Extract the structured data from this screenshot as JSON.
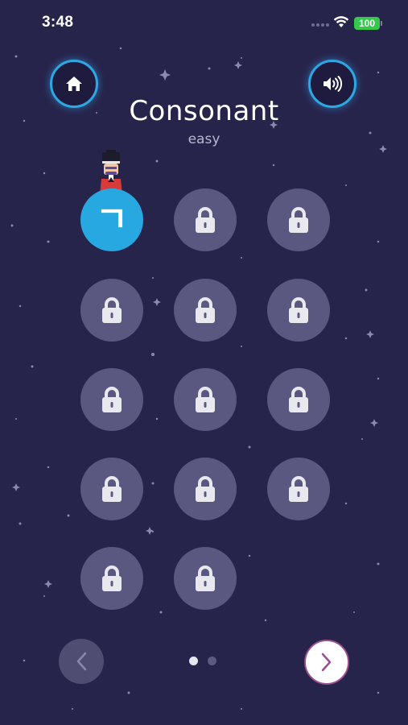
{
  "status_bar": {
    "time": "3:48",
    "battery": "100"
  },
  "header": {
    "title": "Consonant",
    "subtitle": "easy",
    "home_icon": "home-icon",
    "sound_icon": "speaker-volume-icon"
  },
  "levels": [
    {
      "state": "unlocked",
      "symbol": "ㄱ"
    },
    {
      "state": "locked"
    },
    {
      "state": "locked"
    },
    {
      "state": "locked"
    },
    {
      "state": "locked"
    },
    {
      "state": "locked"
    },
    {
      "state": "locked"
    },
    {
      "state": "locked"
    },
    {
      "state": "locked"
    },
    {
      "state": "locked"
    },
    {
      "state": "locked"
    },
    {
      "state": "locked"
    },
    {
      "state": "locked"
    },
    {
      "state": "locked"
    }
  ],
  "pager": {
    "current_page": 1,
    "total_pages": 2,
    "prev_icon": "chevron-left-icon",
    "next_icon": "chevron-right-icon"
  },
  "colors": {
    "background": "#27244c",
    "accent": "#27a8e0",
    "locked_level": "#5a5880",
    "next_border": "#9a4f8e"
  }
}
